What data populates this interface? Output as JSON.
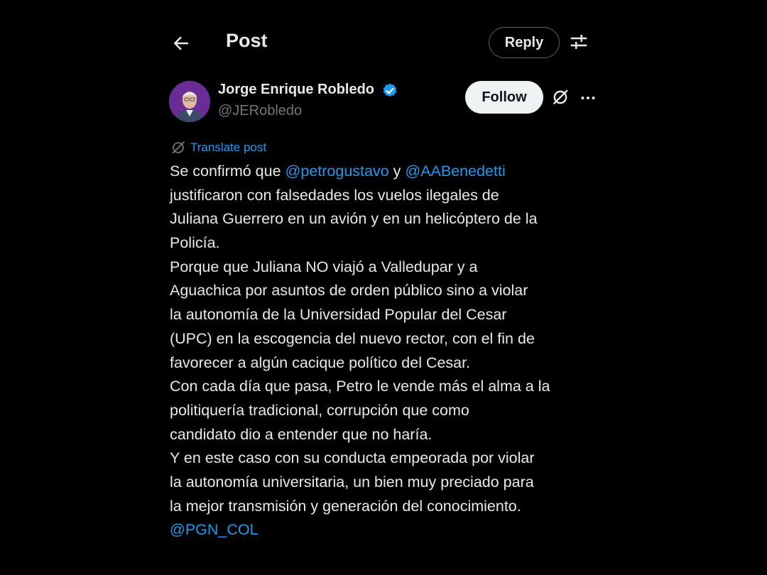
{
  "header": {
    "title": "Post",
    "reply_label": "Reply"
  },
  "author": {
    "name": "Jorge Enrique Robledo",
    "handle": "@JERobledo",
    "verified": true,
    "follow_label": "Follow"
  },
  "translate_label": "Translate post",
  "post": {
    "line1_before": "Se confirmó que ",
    "mention1": "@petrogustavo",
    "line1_mid": " y ",
    "mention2": "@AABenedetti",
    "lines": [
      "justificaron con falsedades los vuelos ilegales de",
      "Juliana Guerrero en un avión y en un helicóptero de la",
      "Policía.",
      "Porque que Juliana NO viajó a Valledupar y a",
      "Aguachica por asuntos de orden público sino a violar",
      "la autonomía de la Universidad  Popular del Cesar",
      "(UPC) en la escogencia del nuevo rector, con el fin de",
      "favorecer a algún cacique político del Cesar.",
      "Con cada día que pasa, Petro le vende más el alma a la",
      "politiquería tradicional, corrupción  que como",
      "candidato dio a entender que no haría.",
      "Y en este caso con su conducta empeorada por violar",
      "la autonomía universitaria, un bien muy preciado para",
      "la mejor transmisión y generación del conocimiento."
    ],
    "mention3": "@PGN_COL"
  },
  "colors": {
    "background": "#000000",
    "text": "#e7e9ea",
    "secondary": "#71767b",
    "link": "#1d9bf0",
    "verified": "#1d9bf0",
    "follow_bg": "#eff3f4",
    "avatar_bg": "#6a2d96"
  },
  "icons": [
    "back-arrow-icon",
    "settings-sliders-icon",
    "verified-badge-icon",
    "grok-icon",
    "more-icon",
    "translate-icon"
  ]
}
